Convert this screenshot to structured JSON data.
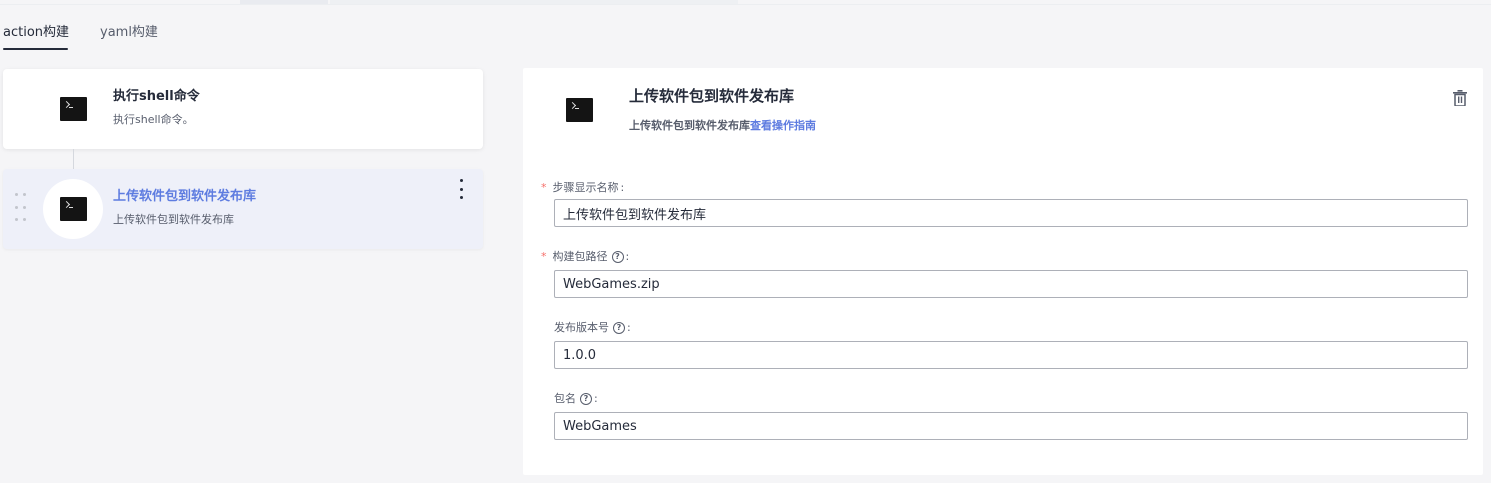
{
  "tabs": [
    {
      "label": "action构建",
      "active": true
    },
    {
      "label": "yaml构建",
      "active": false
    }
  ],
  "steps": [
    {
      "title": "执行shell命令",
      "subtitle": "执行shell命令。",
      "icon": "terminal-icon",
      "selected": false
    },
    {
      "title": "上传软件包到软件发布库",
      "subtitle": "上传软件包到软件发布库",
      "icon": "terminal-icon",
      "selected": true
    }
  ],
  "detail": {
    "title": "上传软件包到软件发布库",
    "description": "上传软件包到软件发布库",
    "guide_link": "查看操作指南",
    "icon": "terminal-icon",
    "delete_icon": "trash-icon"
  },
  "form": {
    "display_name": {
      "label": "步骤显示名称",
      "required": true,
      "value": "上传软件包到软件发布库"
    },
    "package_path": {
      "label": "构建包路径",
      "required": true,
      "value": "WebGames.zip"
    },
    "version": {
      "label": "发布版本号",
      "required": false,
      "value": "1.0.0"
    },
    "package_name": {
      "label": "包名",
      "required": false,
      "value": "WebGames"
    }
  },
  "colors": {
    "accent": "#5e7ce0",
    "required": "#f66f6a",
    "text": "#252b3a",
    "selected_bg": "#eef0f9"
  }
}
